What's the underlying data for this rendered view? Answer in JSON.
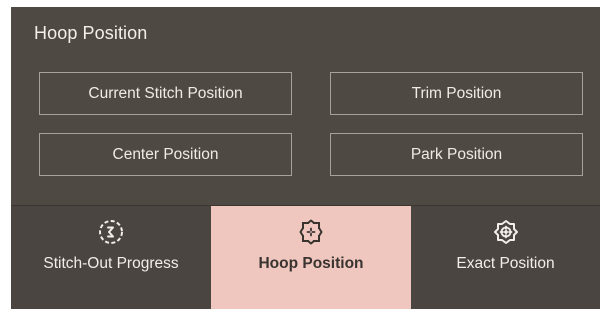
{
  "panel": {
    "title": "Hoop Position"
  },
  "buttons": {
    "current_stitch": "Current Stitch Position",
    "trim": "Trim Position",
    "center": "Center Position",
    "park": "Park Position"
  },
  "tabs": [
    {
      "label": "Stitch-Out Progress",
      "icon": "stitch-out-progress-icon",
      "active": false
    },
    {
      "label": "Hoop Position",
      "icon": "hoop-position-icon",
      "active": true
    },
    {
      "label": "Exact Position",
      "icon": "exact-position-icon",
      "active": false
    }
  ],
  "colors": {
    "panel_bg": "#4f4944",
    "tab_active_bg": "#efc7bf",
    "text_light": "#f2ede8",
    "button_border": "#a8a19a"
  }
}
